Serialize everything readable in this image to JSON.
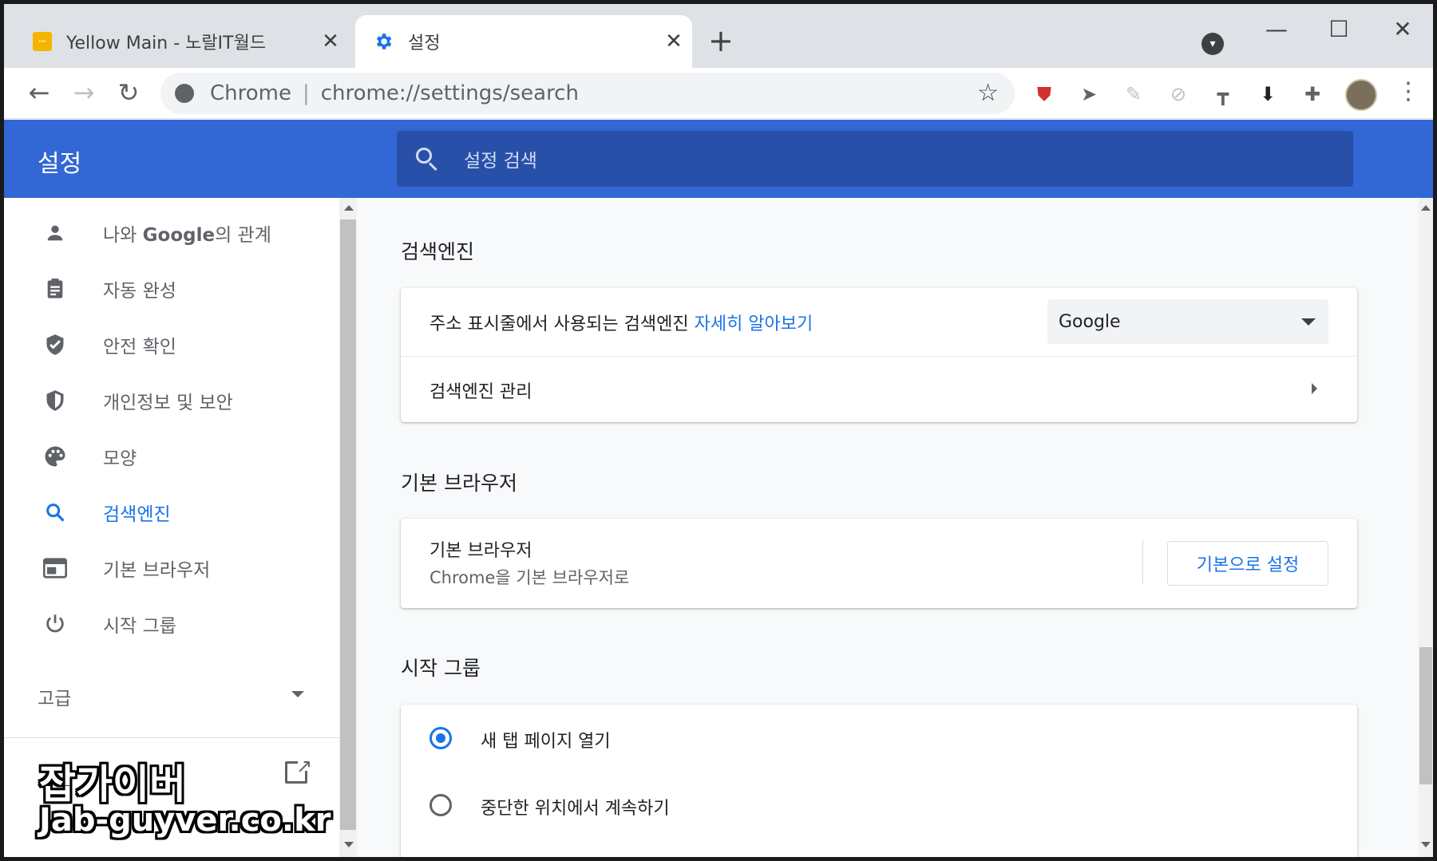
{
  "tabs": [
    {
      "title": "Yellow Main - 노랄IT월드",
      "favicon": "yellow-site-icon",
      "active": false
    },
    {
      "title": "설정",
      "favicon": "gear-icon",
      "active": true
    }
  ],
  "toolbar": {
    "omnibox_site": "Chrome",
    "omnibox_separator": "|",
    "omnibox_url": "chrome://settings/search"
  },
  "header": {
    "title": "설정",
    "search_placeholder": "설정 검색"
  },
  "sidebar": {
    "items": [
      {
        "label_pre": "나와 ",
        "label_bold": "Google",
        "label_post": "의 관계",
        "icon": "person-icon"
      },
      {
        "label": "자동 완성",
        "icon": "clipboard-icon"
      },
      {
        "label": "안전 확인",
        "icon": "shield-check-icon"
      },
      {
        "label": "개인정보 및 보안",
        "icon": "shield-icon"
      },
      {
        "label": "모양",
        "icon": "palette-icon"
      },
      {
        "label": "검색엔진",
        "icon": "search-icon",
        "active": true
      },
      {
        "label": "기본 브라우저",
        "icon": "browser-window-icon"
      },
      {
        "label": "시작 그룹",
        "icon": "power-icon"
      }
    ],
    "advanced_label": "고급"
  },
  "sections": {
    "search_engine": {
      "title": "검색엔진",
      "row1_text": "주소 표시줄에서 사용되는 검색엔진",
      "row1_link": "자세히 알아보기",
      "select_value": "Google",
      "row2_text": "검색엔진 관리"
    },
    "default_browser": {
      "title": "기본 브라우저",
      "row_title": "기본 브라우저",
      "row_sub": "Chrome을 기본 브라우저로",
      "button": "기본으로 설정"
    },
    "startup": {
      "title": "시작 그룹",
      "options": [
        {
          "label": "새 탭 페이지 열기",
          "checked": true
        },
        {
          "label": "중단한 위치에서 계속하기",
          "checked": false
        }
      ]
    }
  },
  "watermark": {
    "line1": "잡가이버",
    "line2": "Jab-guyver.co.kr"
  },
  "colors": {
    "header_blue": "#3367d6",
    "search_box": "#2850a8",
    "accent": "#1a73e8"
  }
}
